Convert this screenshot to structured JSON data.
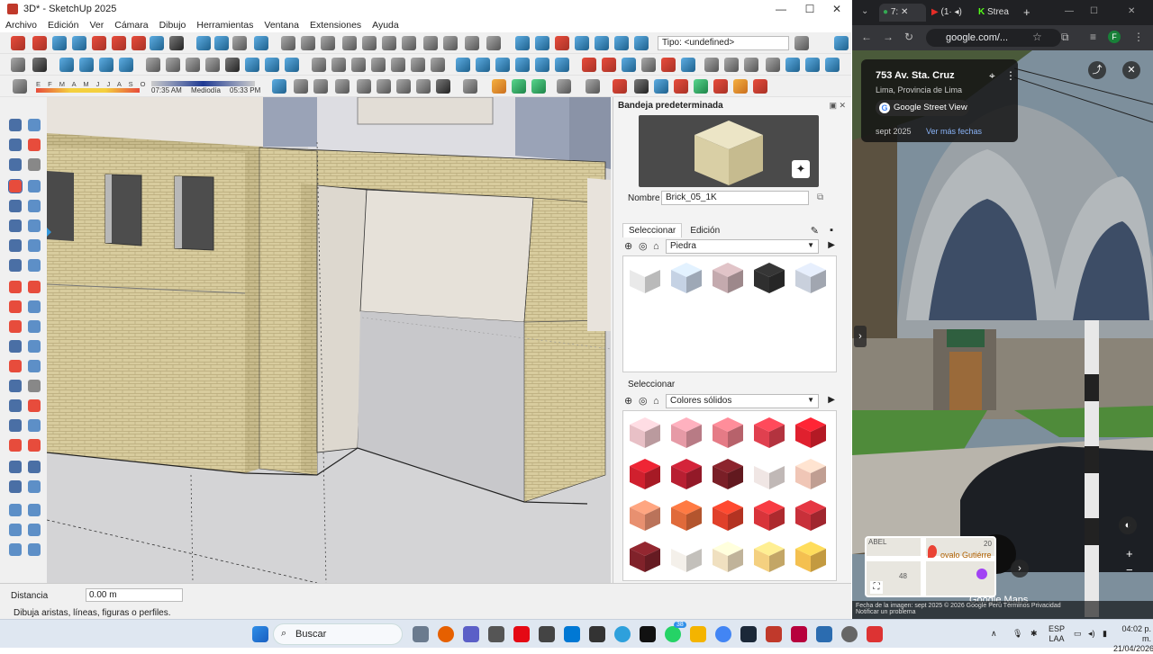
{
  "sketchup": {
    "title": "3D* - SketchUp 2025",
    "menu": [
      "Archivo",
      "Edición",
      "Ver",
      "Cámara",
      "Dibujo",
      "Herramientas",
      "Ventana",
      "Extensiones",
      "Ayuda"
    ],
    "tipo_field": "Tipo: <undefined>",
    "shadow_months": "E F M A M J J A S O N D",
    "times": {
      "start": "07:35 AM",
      "mid": "Mediodía",
      "end": "05:33 PM"
    },
    "tray": {
      "title": "Bandeja predeterminada",
      "nombre_label": "Nombre",
      "nombre_value": "Brick_05_1K",
      "tabs": [
        "Seleccionar",
        "Edición"
      ],
      "library1": "Piedra",
      "section2_label": "Seleccionar",
      "library2": "Colores sólidos",
      "stone_colors": [
        "#e9e9e9",
        "#c5d2e4",
        "#c4aaae",
        "#2f2f2f",
        "#c9d0dc"
      ],
      "solid_colors": [
        "#e8c0c6",
        "#e69aa6",
        "#e57b86",
        "#e0404f",
        "#e0202e",
        "#d0202e",
        "#b81f32",
        "#7a1f27",
        "#f0e6e4",
        "#f0c6b6",
        "#e89070",
        "#e06a3a",
        "#e0402a",
        "#d8343a",
        "#c8303a",
        "#80222a",
        "#f4f0ea",
        "#f0e0c0",
        "#f4d080",
        "#f4c050"
      ]
    },
    "distance_label": "Distancia",
    "distance_value": "0.00 m",
    "hint": "Dibuja aristas, líneas, figuras o perfiles."
  },
  "chrome": {
    "tabs": [
      "7:",
      "(1·",
      "Strea"
    ],
    "url": "google.com/...",
    "sv": {
      "address": "753 Av. Sta. Cruz",
      "city": "Lima, Provincia de Lima",
      "service": "Google Street View",
      "date": "sept 2025",
      "more": "Ver más fechas"
    },
    "map_labels": {
      "place": "ovalo Gutiérre",
      "n1": "20",
      "n2": "48",
      "street": "ABEL"
    },
    "google_maps": "Google Maps",
    "footer": "Fecha de la imagen: sept 2025   © 2026 Google   Perú   Términos   Privacidad",
    "footer2": "Notificar un problema"
  },
  "taskbar": {
    "search": "Buscar",
    "badge": "38",
    "lang1": "ESP",
    "lang2": "LAA",
    "time": "04:02 p. m.",
    "date": "21/04/2026"
  }
}
